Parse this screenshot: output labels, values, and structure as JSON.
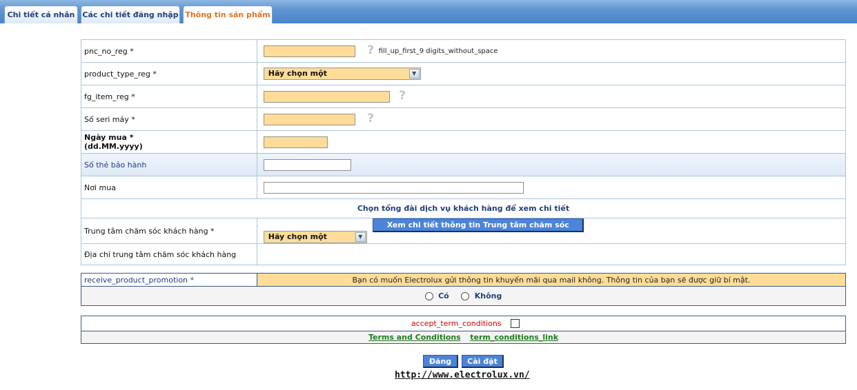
{
  "tabs": [
    {
      "label": "Chi tiết cá nhân"
    },
    {
      "label": "Các chi tiết đăng nhập"
    },
    {
      "label": "Thông tin sản phẩm"
    }
  ],
  "form": {
    "pnc": {
      "label": "pnc_no_reg *",
      "hint": "fill_up_first_9 digits_without_space"
    },
    "product_type": {
      "label": "product_type_reg *",
      "selected": "Hãy chọn một"
    },
    "fg_item": {
      "label": "fg_item_reg *"
    },
    "serial": {
      "label": "Số seri máy *"
    },
    "purchase_date": {
      "label_line1": "Ngày mua *",
      "label_line2": "(dd.MM.yyyy)"
    },
    "warranty": {
      "label": "Số thẻ bảo hành"
    },
    "place": {
      "label": "Nơi mua"
    },
    "service_hint": "Chọn tổng đài dịch vụ khách hàng để xem chi tiết",
    "care_center": {
      "label": "Trung tâm chăm sóc khách hàng *",
      "selected": "Hãy chọn một",
      "button": "Xem chi tiết thông tin Trung tâm chăm sóc khách hàng"
    },
    "care_address": {
      "label": "Địa chỉ trung tâm chăm sóc khách hàng"
    }
  },
  "promotion": {
    "label": "receive_product_promotion *",
    "text": "Bạn có muốn Electrolux gửi thông tin khuyến mãi qua mail không. Thông tin của bạn sẽ được giữ bí mật.",
    "yes": "Có",
    "no": "Không"
  },
  "terms": {
    "label": "accept_term_conditions",
    "link1": "Terms and Conditions",
    "link2": "term_conditions_link"
  },
  "buttons": {
    "register": "Đăng ký",
    "reset": "Cài đặt lại"
  },
  "footer": {
    "url": "http://www.electrolux.vn/"
  }
}
